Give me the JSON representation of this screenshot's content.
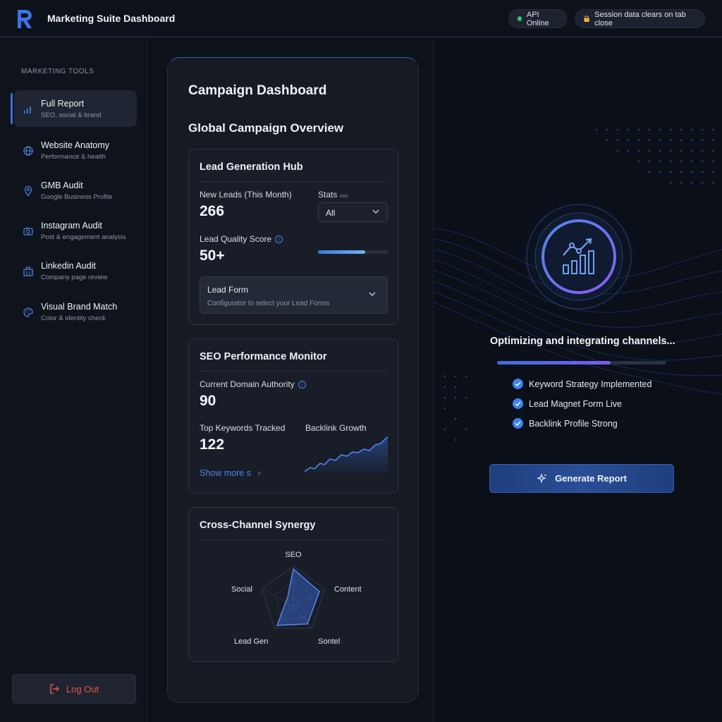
{
  "header": {
    "app_title": "Marketing Suite Dashboard",
    "api_status": "API Online",
    "session_note": "Session data clears on tab close"
  },
  "sidebar": {
    "heading": "MARKETING TOOLS",
    "items": [
      {
        "label": "Full Report",
        "sub": "SEO, social & brand",
        "icon": "bar-chart-icon",
        "active": true
      },
      {
        "label": "Website Anatomy",
        "sub": "Performance & health",
        "icon": "globe-icon",
        "active": false
      },
      {
        "label": "GMB Audit",
        "sub": "Google Business Profile",
        "icon": "location-pin-icon",
        "active": false
      },
      {
        "label": "Instagram Audit",
        "sub": "Post & engagement analysis",
        "icon": "camera-icon",
        "active": false
      },
      {
        "label": "Linkedin Audit",
        "sub": "Company page review",
        "icon": "building-icon",
        "active": false
      },
      {
        "label": "Visual Brand Match",
        "sub": "Color & identity check",
        "icon": "palette-icon",
        "active": false
      }
    ],
    "logout_label": "Log Out"
  },
  "dashboard": {
    "title": "Campaign Dashboard",
    "subtitle": "Global Campaign Overview",
    "lead_hub": {
      "title": "Lead Generation Hub",
      "new_leads_label": "New Leads (This Month)",
      "new_leads_value": "266",
      "stats_label": "Stats",
      "stats_note": "ɪɪʀɪ:",
      "stats_selected": "All",
      "quality_label": "Lead Quality Score",
      "quality_value": "50+",
      "quality_bar_fraction": 0.68,
      "lead_form_title": "Lead Form",
      "lead_form_sub": "Configurator to select your Lead Forms"
    },
    "seo": {
      "title": "SEO Performance Monitor",
      "domain_authority_label": "Current Domain Authority",
      "domain_authority_value": "90",
      "keywords_label": "Top Keywords Tracked",
      "keywords_value": "122",
      "backlink_label": "Backlink Growth",
      "show_more": "Show more s"
    },
    "synergy": {
      "title": "Cross-Channel Synergy",
      "axes": [
        "SEO",
        "Content",
        "Sontel",
        "Lead Gen",
        "Social"
      ]
    }
  },
  "right_panel": {
    "status_text": "Optimizing and integrating channels...",
    "progress_fraction": 0.67,
    "checklist": [
      "Keyword Strategy Implemented",
      "Lead Magnet Form Live",
      "Backlink Profile Strong"
    ],
    "generate_label": "Generate Report"
  },
  "colors": {
    "accent": "#3b6fe0",
    "danger": "#e8574a",
    "online": "#34c76a"
  }
}
